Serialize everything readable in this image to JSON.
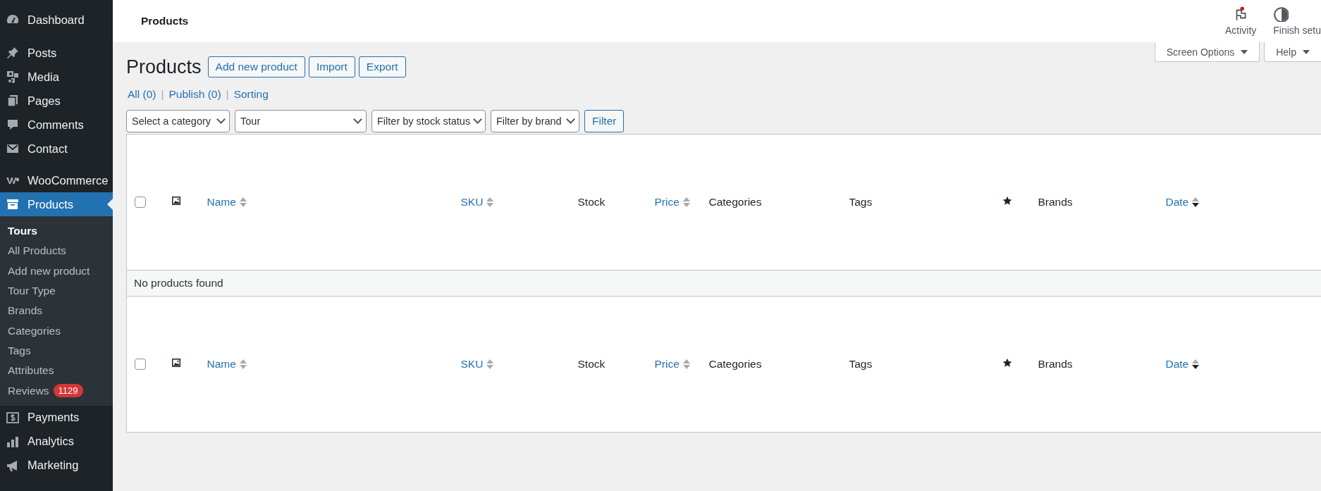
{
  "sidebar": {
    "items": [
      {
        "label": "Dashboard",
        "selected": false
      },
      {
        "label": "Posts",
        "selected": false
      },
      {
        "label": "Media",
        "selected": false
      },
      {
        "label": "Pages",
        "selected": false
      },
      {
        "label": "Comments",
        "selected": false
      },
      {
        "label": "Contact",
        "selected": false
      },
      {
        "label": "WooCommerce",
        "selected": false
      },
      {
        "label": "Products",
        "selected": true,
        "children": [
          {
            "label": "Tours",
            "selected": true
          },
          {
            "label": "All Products",
            "selected": false
          },
          {
            "label": "Add new product",
            "selected": false
          },
          {
            "label": "Tour Type",
            "selected": false
          },
          {
            "label": "Brands",
            "selected": false
          },
          {
            "label": "Categories",
            "selected": false
          },
          {
            "label": "Tags",
            "selected": false
          },
          {
            "label": "Attributes",
            "selected": false
          },
          {
            "label": "Reviews",
            "selected": false,
            "badge": "1129"
          }
        ]
      },
      {
        "label": "Payments",
        "selected": false
      },
      {
        "label": "Analytics",
        "selected": false
      },
      {
        "label": "Marketing",
        "selected": false
      }
    ]
  },
  "header": {
    "title": "Products",
    "actions": [
      {
        "label": "Activity",
        "kind": "activity",
        "notification": true
      },
      {
        "label": "Finish setu",
        "kind": "setup",
        "notification": false
      }
    ]
  },
  "screen_tabs": [
    "Screen Options",
    "Help"
  ],
  "page": {
    "title": "Products",
    "buttons": [
      "Add new product",
      "Import",
      "Export"
    ]
  },
  "views": [
    {
      "kind": "link",
      "text": "All (0)"
    },
    {
      "kind": "separator",
      "text": "|"
    },
    {
      "kind": "link",
      "text": "Publish (0)"
    },
    {
      "kind": "separator",
      "text": "|"
    },
    {
      "kind": "link",
      "text": "Sorting"
    }
  ],
  "filters": {
    "selects": [
      "Select a category",
      "Tour",
      "Filter by stock status",
      "Filter by brand"
    ],
    "button": "Filter"
  },
  "table": {
    "header_columns": [
      {
        "kind": "checkbox",
        "checked": false
      },
      {
        "kind": "image"
      },
      {
        "kind": "text",
        "label": "Name",
        "sortable": true,
        "sorted": false
      },
      {
        "kind": "text",
        "label": "SKU",
        "sortable": true,
        "sorted": false
      },
      {
        "kind": "text",
        "label": "Stock",
        "sortable": false
      },
      {
        "kind": "text",
        "label": "Price",
        "sortable": true,
        "sorted": false
      },
      {
        "kind": "text",
        "label": "Categories",
        "sortable": false
      },
      {
        "kind": "text",
        "label": "Tags",
        "sortable": false
      },
      {
        "kind": "featured"
      },
      {
        "kind": "text",
        "label": "Brands",
        "sortable": false
      },
      {
        "kind": "text",
        "label": "Date",
        "sortable": true,
        "sorted": true
      }
    ],
    "footer_columns": [
      {
        "kind": "checkbox",
        "checked": false
      },
      {
        "kind": "image"
      },
      {
        "kind": "text",
        "label": "Name",
        "sortable": true,
        "sorted": false
      },
      {
        "kind": "text",
        "label": "SKU",
        "sortable": true,
        "sorted": false
      },
      {
        "kind": "text",
        "label": "Stock",
        "sortable": false
      },
      {
        "kind": "text",
        "label": "Price",
        "sortable": true,
        "sorted": false
      },
      {
        "kind": "text",
        "label": "Categories",
        "sortable": false
      },
      {
        "kind": "text",
        "label": "Tags",
        "sortable": false
      },
      {
        "kind": "featured"
      },
      {
        "kind": "text",
        "label": "Brands",
        "sortable": false
      },
      {
        "kind": "text",
        "label": "Date",
        "sortable": true,
        "sorted": true
      }
    ],
    "empty_message": "No products found"
  }
}
